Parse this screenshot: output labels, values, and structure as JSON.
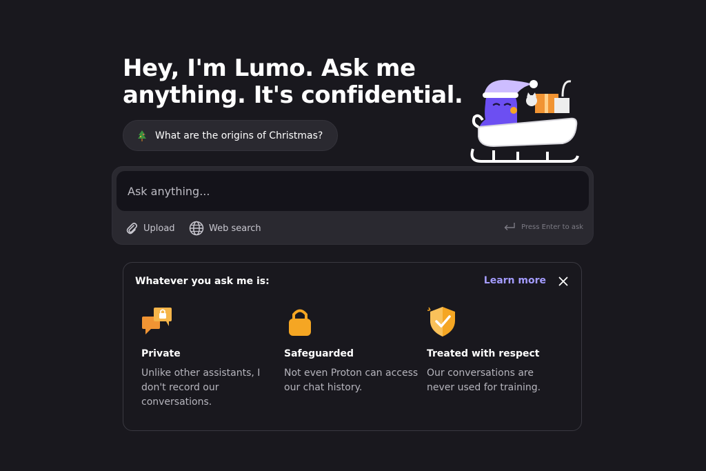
{
  "hero": {
    "title_line1": "Hey, I'm Lumo. Ask me",
    "title_line2": "anything. It's confidential."
  },
  "suggestion": {
    "icon": "christmas-tree-icon",
    "label": "What are the origins of Christmas?"
  },
  "composer": {
    "placeholder": "Ask anything...",
    "upload_label": "Upload",
    "web_search_label": "Web search",
    "enter_hint": "Press Enter to ask"
  },
  "info": {
    "title": "Whatever you ask me is:",
    "learn_more": "Learn more",
    "features": [
      {
        "icon": "chat-bubbles-lock-icon",
        "title": "Private",
        "description": "Unlike other assistants, I don't record our conversations."
      },
      {
        "icon": "padlock-icon",
        "title": "Safeguarded",
        "description": "Not even Proton can access our chat history."
      },
      {
        "icon": "shield-check-icon",
        "title": "Treated with respect",
        "description": "Our conversations are never used for training."
      }
    ]
  },
  "colors": {
    "background": "#19181e",
    "surface": "#2a2930",
    "accent_link": "#a49cff",
    "icon_orange": "#f5a623",
    "mascot_purple": "#6c4ff2"
  }
}
